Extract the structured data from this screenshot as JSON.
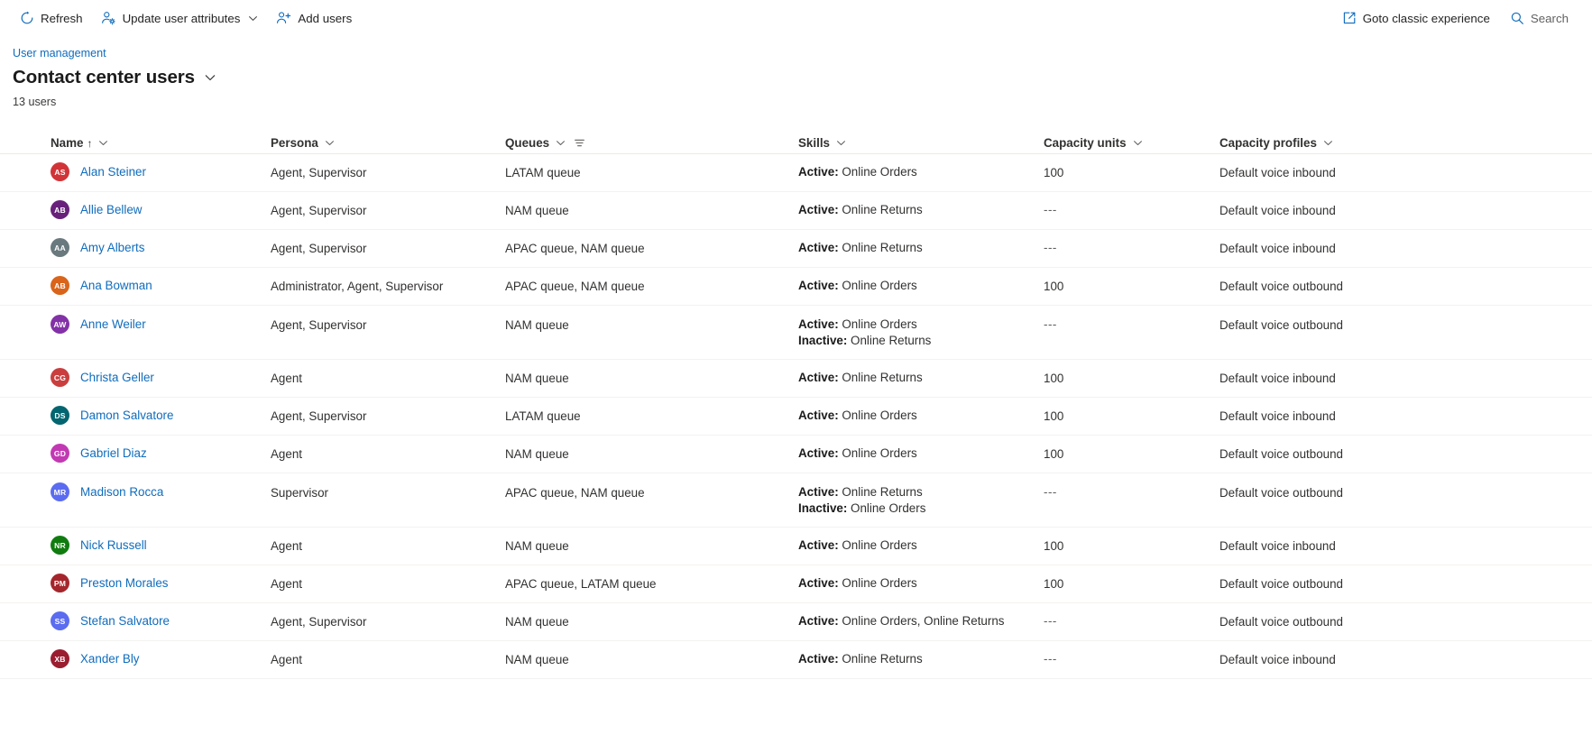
{
  "commandbar": {
    "left_items": [
      {
        "label": "Refresh",
        "icon": "refresh-icon",
        "has_chevron": false
      },
      {
        "label": "Update user attributes",
        "icon": "user-settings-icon",
        "has_chevron": true
      },
      {
        "label": "Add users",
        "icon": "add-user-icon",
        "has_chevron": false
      }
    ],
    "right_items": [
      {
        "label": "Goto classic experience",
        "icon": "external-link-icon"
      },
      {
        "label": "Search",
        "icon": "search-icon"
      }
    ]
  },
  "header": {
    "breadcrumb": "User management",
    "title": "Contact center users",
    "title_chevron_icon": "chevron-down-icon",
    "count_label": "13 users"
  },
  "grid": {
    "columns": [
      {
        "label": "Name",
        "sort": "ascending",
        "sort_glyph": "↑",
        "has_chevron": true,
        "has_filter": false
      },
      {
        "label": "Persona",
        "has_chevron": true,
        "has_filter": false
      },
      {
        "label": "Queues",
        "has_chevron": true,
        "has_filter": true
      },
      {
        "label": "Skills",
        "has_chevron": true,
        "has_filter": false
      },
      {
        "label": "Capacity units",
        "has_chevron": true,
        "has_filter": false
      },
      {
        "label": "Capacity profiles",
        "has_chevron": true,
        "has_filter": false
      }
    ],
    "rows": [
      {
        "initials": "AS",
        "avatar_color": "#d13438",
        "name": "Alan Steiner",
        "persona": "Agent, Supervisor",
        "queues": "LATAM queue",
        "skills": [
          {
            "state": "Active:",
            "value": "Online Orders"
          }
        ],
        "capacity_units": "100",
        "capacity_profiles": "Default voice inbound"
      },
      {
        "initials": "AB",
        "avatar_color": "#68217a",
        "name": "Allie Bellew",
        "persona": "Agent, Supervisor",
        "queues": "NAM queue",
        "skills": [
          {
            "state": "Active:",
            "value": "Online Returns"
          }
        ],
        "capacity_units": "---",
        "capacity_profiles": "Default voice inbound"
      },
      {
        "initials": "AA",
        "avatar_color": "#69797e",
        "name": "Amy Alberts",
        "persona": "Agent, Supervisor",
        "queues": "APAC queue, NAM queue",
        "skills": [
          {
            "state": "Active:",
            "value": "Online Returns"
          }
        ],
        "capacity_units": "---",
        "capacity_profiles": "Default voice inbound"
      },
      {
        "initials": "AB",
        "avatar_color": "#d9641a",
        "name": "Ana Bowman",
        "persona": "Administrator, Agent, Supervisor",
        "queues": "APAC queue, NAM queue",
        "skills": [
          {
            "state": "Active:",
            "value": "Online Orders"
          }
        ],
        "capacity_units": "100",
        "capacity_profiles": "Default voice outbound"
      },
      {
        "initials": "AW",
        "avatar_color": "#8331a7",
        "name": "Anne Weiler",
        "persona": "Agent, Supervisor",
        "queues": "NAM queue",
        "skills": [
          {
            "state": "Active:",
            "value": "Online Orders"
          },
          {
            "state": "Inactive:",
            "value": "Online Returns"
          }
        ],
        "capacity_units": "---",
        "capacity_profiles": "Default voice outbound"
      },
      {
        "initials": "CG",
        "avatar_color": "#ca3e3e",
        "name": "Christa Geller",
        "persona": "Agent",
        "queues": "NAM queue",
        "skills": [
          {
            "state": "Active:",
            "value": "Online Returns"
          }
        ],
        "capacity_units": "100",
        "capacity_profiles": "Default voice inbound"
      },
      {
        "initials": "DS",
        "avatar_color": "#03656f",
        "name": "Damon Salvatore",
        "persona": "Agent, Supervisor",
        "queues": "LATAM queue",
        "skills": [
          {
            "state": "Active:",
            "value": "Online Orders"
          }
        ],
        "capacity_units": "100",
        "capacity_profiles": "Default voice inbound"
      },
      {
        "initials": "GD",
        "avatar_color": "#c239b3",
        "name": "Gabriel Diaz",
        "persona": "Agent",
        "queues": "NAM queue",
        "skills": [
          {
            "state": "Active:",
            "value": "Online Orders"
          }
        ],
        "capacity_units": "100",
        "capacity_profiles": "Default voice outbound"
      },
      {
        "initials": "MR",
        "avatar_color": "#5b6cf0",
        "name": "Madison Rocca",
        "persona": "Supervisor",
        "queues": "APAC queue, NAM queue",
        "skills": [
          {
            "state": "Active:",
            "value": "Online Returns"
          },
          {
            "state": "Inactive:",
            "value": "Online Orders"
          }
        ],
        "capacity_units": "---",
        "capacity_profiles": "Default voice outbound"
      },
      {
        "initials": "NR",
        "avatar_color": "#107c10",
        "name": "Nick Russell",
        "persona": "Agent",
        "queues": "NAM queue",
        "skills": [
          {
            "state": "Active:",
            "value": "Online Orders"
          }
        ],
        "capacity_units": "100",
        "capacity_profiles": "Default voice inbound"
      },
      {
        "initials": "PM",
        "avatar_color": "#a4262c",
        "name": "Preston Morales",
        "persona": "Agent",
        "queues": "APAC queue, LATAM queue",
        "skills": [
          {
            "state": "Active:",
            "value": "Online Orders"
          }
        ],
        "capacity_units": "100",
        "capacity_profiles": "Default voice outbound"
      },
      {
        "initials": "SS",
        "avatar_color": "#5b6cf0",
        "name": "Stefan Salvatore",
        "persona": "Agent, Supervisor",
        "queues": "NAM queue",
        "skills": [
          {
            "state": "Active:",
            "value": "Online Orders, Online Returns"
          }
        ],
        "capacity_units": "---",
        "capacity_profiles": "Default voice outbound"
      },
      {
        "initials": "XB",
        "avatar_color": "#9b1d30",
        "name": "Xander Bly",
        "persona": "Agent",
        "queues": "NAM queue",
        "skills": [
          {
            "state": "Active:",
            "value": "Online Returns"
          }
        ],
        "capacity_units": "---",
        "capacity_profiles": "Default voice inbound"
      }
    ]
  },
  "colors": {
    "link": "#0f6cbd",
    "text": "#323130",
    "row_divider": "#f3f2f1"
  }
}
